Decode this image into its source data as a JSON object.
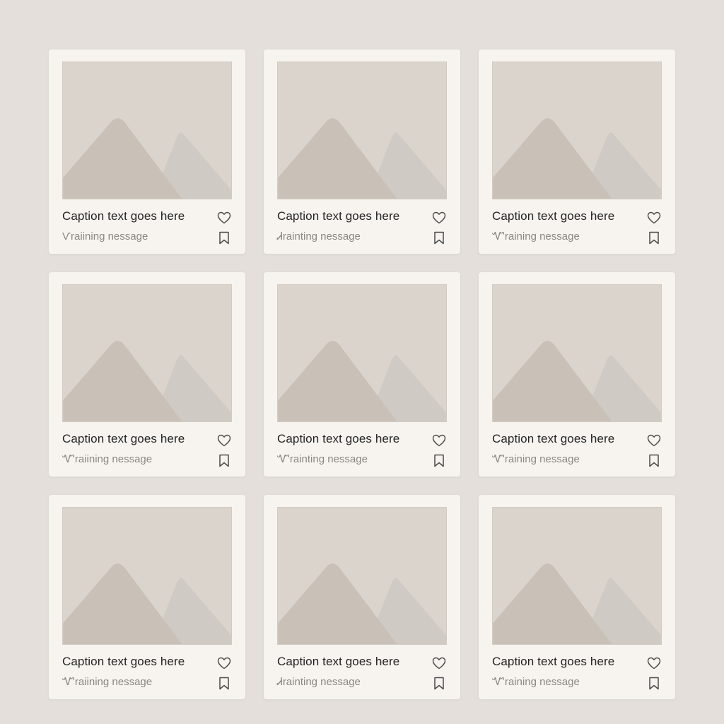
{
  "colors": {
    "page_background": "#e4dfda",
    "card_background": "#f7f4ef",
    "image_background": "#dad4cd",
    "mountain_front": "#c9c1b7",
    "mountain_back": "#cfcac3",
    "icon_stroke": "#4a4a4a"
  },
  "icons": {
    "like": "heart-icon",
    "save": "bookmark-icon",
    "thumbnail": "image-placeholder-icon"
  },
  "cards": [
    {
      "caption": "Caption text goes here",
      "subtext": "Ѵraiining nessage"
    },
    {
      "caption": "Caption text goes here",
      "subtext": "Ꮧrainting nessage"
    },
    {
      "caption": "Caption text goes here",
      "subtext": "Ꮙraining nessage"
    },
    {
      "caption": "Caption text goes here",
      "subtext": "Ꮙraiining nessage"
    },
    {
      "caption": "Caption text goes here",
      "subtext": "Ꮙrainting nessage"
    },
    {
      "caption": "Caption text goes here",
      "subtext": "Ꮙraining nessage"
    },
    {
      "caption": "Caption text goes here",
      "subtext": "Ꮙraiining nessage"
    },
    {
      "caption": "Caption text goes here",
      "subtext": "Ꮧrainting nessage"
    },
    {
      "caption": "Caption text goes here",
      "subtext": "Ꮙraining nessage"
    }
  ]
}
